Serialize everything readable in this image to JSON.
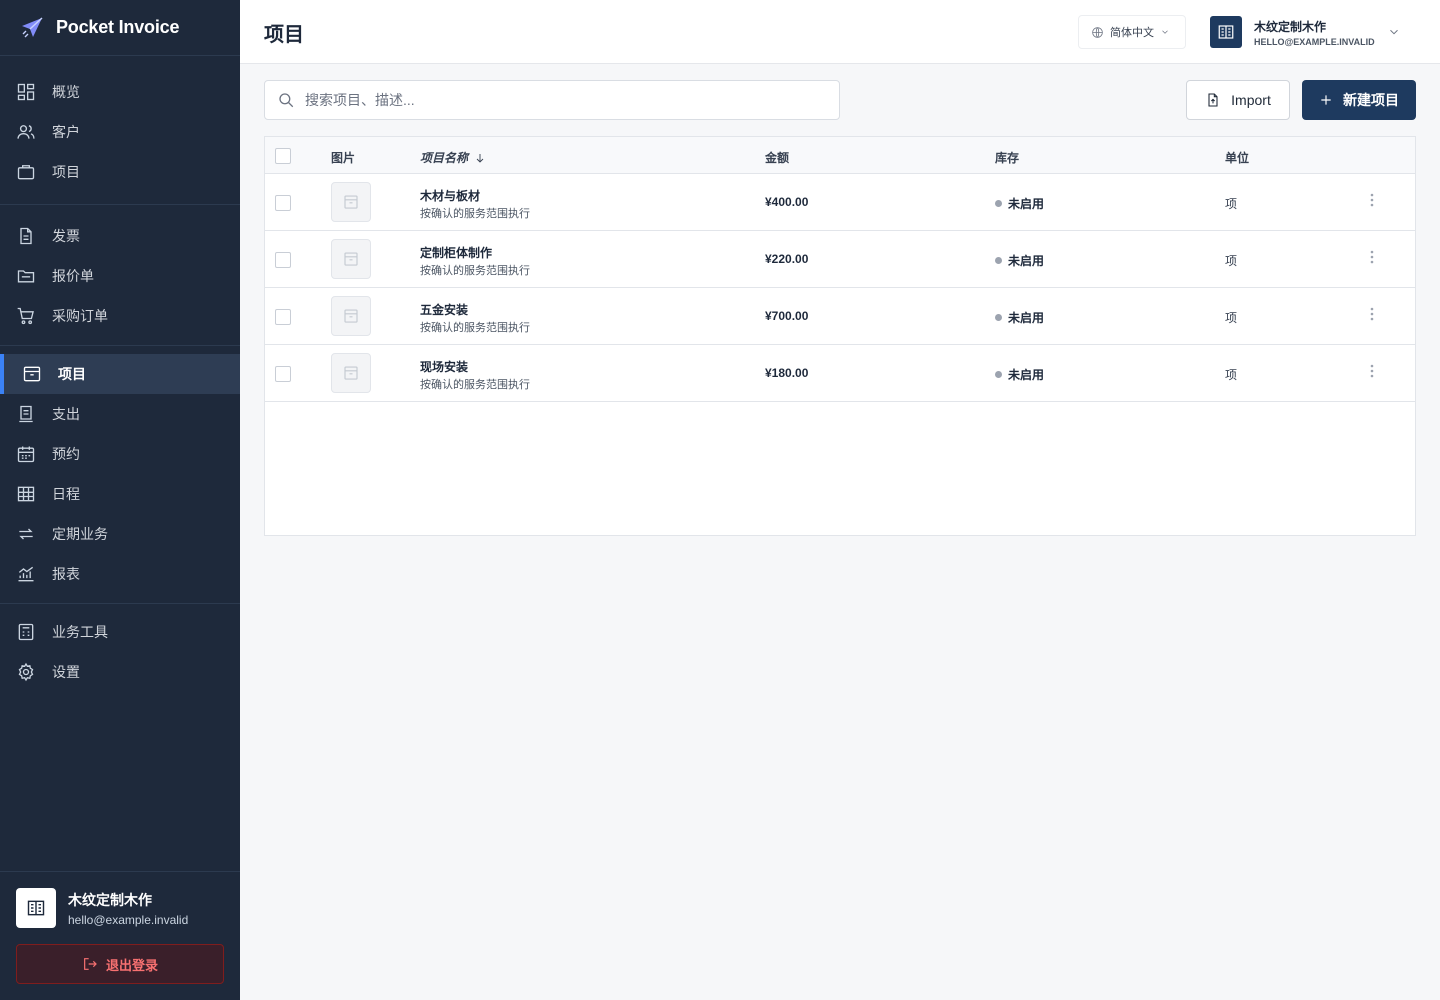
{
  "app": {
    "name": "Pocket Invoice"
  },
  "sidebar": {
    "groups": [
      [
        {
          "label": "概览",
          "icon": "dashboard-icon"
        },
        {
          "label": "客户",
          "icon": "users-icon"
        },
        {
          "label": "项目",
          "icon": "briefcase-icon"
        }
      ],
      [
        {
          "label": "发票",
          "icon": "document-icon"
        },
        {
          "label": "报价单",
          "icon": "folder-icon"
        },
        {
          "label": "采购订单",
          "icon": "cart-icon"
        }
      ],
      [
        {
          "label": "项目",
          "icon": "archive-icon",
          "active": true
        },
        {
          "label": "支出",
          "icon": "receipt-icon"
        },
        {
          "label": "预约",
          "icon": "calendar-icon"
        },
        {
          "label": "日程",
          "icon": "table-icon"
        },
        {
          "label": "定期业务",
          "icon": "repeat-icon"
        },
        {
          "label": "报表",
          "icon": "chart-icon"
        }
      ],
      [
        {
          "label": "业务工具",
          "icon": "calculator-icon"
        },
        {
          "label": "设置",
          "icon": "gear-icon"
        }
      ]
    ],
    "user": {
      "name": "木纹定制木作",
      "email": "hello@example.invalid"
    },
    "logout_label": "退出登录"
  },
  "header": {
    "title": "项目",
    "language": "简体中文",
    "org_name": "木纹定制木作",
    "org_email": "HELLO@EXAMPLE.INVALID"
  },
  "toolbar": {
    "search_placeholder": "搜索项目、描述...",
    "import_label": "Import",
    "new_label": "新建项目"
  },
  "table": {
    "columns": {
      "image": "图片",
      "name": "项目名称",
      "amount": "金额",
      "stock": "库存",
      "unit": "单位"
    },
    "rows": [
      {
        "name": "木材与板材",
        "desc": "按确认的服务范围执行",
        "amount": "¥400.00",
        "stock": "未启用",
        "unit": "项"
      },
      {
        "name": "定制柜体制作",
        "desc": "按确认的服务范围执行",
        "amount": "¥220.00",
        "stock": "未启用",
        "unit": "项"
      },
      {
        "name": "五金安装",
        "desc": "按确认的服务范围执行",
        "amount": "¥700.00",
        "stock": "未启用",
        "unit": "项"
      },
      {
        "name": "现场安装",
        "desc": "按确认的服务范围执行",
        "amount": "¥180.00",
        "stock": "未启用",
        "unit": "项"
      }
    ]
  },
  "colors": {
    "sidebar_bg": "#1e293b",
    "primary": "#1e3a5f",
    "active_accent": "#3b82f6",
    "danger": "#f87171"
  }
}
